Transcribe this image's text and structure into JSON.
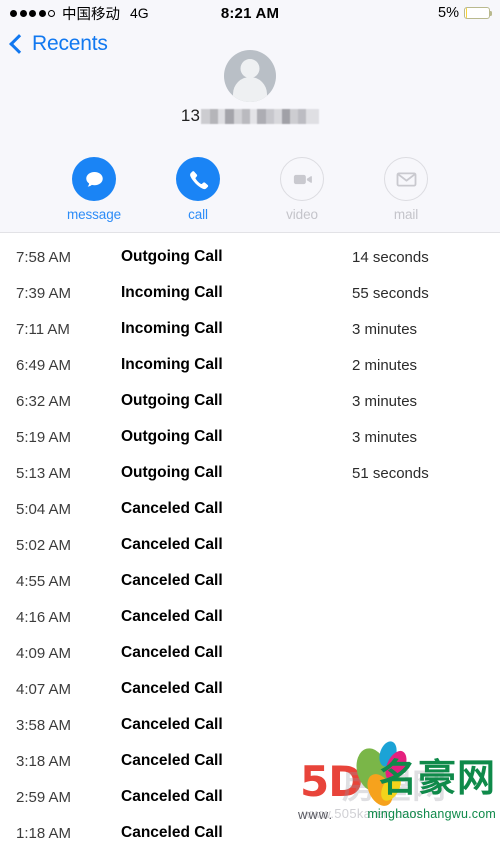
{
  "status_bar": {
    "signal_dots_filled": 4,
    "signal_dots_total": 5,
    "carrier": "中国移动",
    "network": "4G",
    "time": "8:21 AM",
    "battery_percent": "5%",
    "battery_level": 5,
    "battery_color": "#f6d33c"
  },
  "navbar": {
    "back_label": "Recents"
  },
  "contact": {
    "phone_prefix": "13",
    "phone_redacted": true,
    "avatar_icon": "person-placeholder-icon"
  },
  "actions": [
    {
      "label": "message",
      "icon": "message-bubble-icon",
      "enabled": true
    },
    {
      "label": "call",
      "icon": "phone-handset-icon",
      "enabled": true
    },
    {
      "label": "video",
      "icon": "video-camera-icon",
      "enabled": false
    },
    {
      "label": "mail",
      "icon": "envelope-icon",
      "enabled": false
    }
  ],
  "colors": {
    "accent_blue": "#1a84f5",
    "label_blue": "#2d8cf7",
    "disabled_gray": "#c4c4ca",
    "header_bg": "#f7f7fb"
  },
  "call_list": [
    {
      "time": "7:58 AM",
      "type": "Outgoing Call",
      "duration": "14 seconds"
    },
    {
      "time": "7:39 AM",
      "type": "Incoming Call",
      "duration": "55 seconds"
    },
    {
      "time": "7:11 AM",
      "type": "Incoming Call",
      "duration": "3 minutes"
    },
    {
      "time": "6:49 AM",
      "type": "Incoming Call",
      "duration": "2 minutes"
    },
    {
      "time": "6:32 AM",
      "type": "Outgoing Call",
      "duration": "3 minutes"
    },
    {
      "time": "5:19 AM",
      "type": "Outgoing Call",
      "duration": "3 minutes"
    },
    {
      "time": "5:13 AM",
      "type": "Outgoing Call",
      "duration": "51 seconds"
    },
    {
      "time": "5:04 AM",
      "type": "Canceled Call",
      "duration": ""
    },
    {
      "time": "5:02 AM",
      "type": "Canceled Call",
      "duration": ""
    },
    {
      "time": "4:55 AM",
      "type": "Canceled Call",
      "duration": ""
    },
    {
      "time": "4:16 AM",
      "type": "Canceled Call",
      "duration": ""
    },
    {
      "time": "4:09 AM",
      "type": "Canceled Call",
      "duration": ""
    },
    {
      "time": "4:07 AM",
      "type": "Canceled Call",
      "duration": ""
    },
    {
      "time": "3:58 AM",
      "type": "Canceled Call",
      "duration": ""
    },
    {
      "time": "3:18 AM",
      "type": "Canceled Call",
      "duration": ""
    },
    {
      "time": "2:59 AM",
      "type": "Canceled Call",
      "duration": ""
    },
    {
      "time": "1:18 AM",
      "type": "Canceled Call",
      "duration": ""
    }
  ],
  "watermark": {
    "logo_5d": "5D",
    "ghost_text": "房望网",
    "ghost_url": "www.505karen.com",
    "brand_cn": "名豪网",
    "brand_url": "minghaoshangwu.com",
    "www_prefix": "www."
  }
}
